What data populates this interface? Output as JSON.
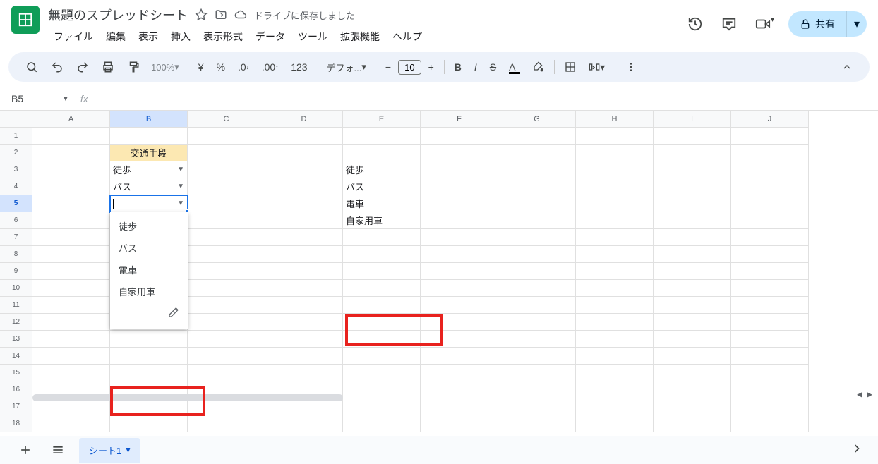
{
  "header": {
    "doc_title": "無題のスプレッドシート",
    "save_status": "ドライブに保存しました",
    "share_label": "共有"
  },
  "menubar": [
    "ファイル",
    "編集",
    "表示",
    "挿入",
    "表示形式",
    "データ",
    "ツール",
    "拡張機能",
    "ヘルプ"
  ],
  "toolbar": {
    "zoom": "100%",
    "currency": "¥",
    "percent": "%",
    "dec_dec": ".0",
    "inc_dec": ".00",
    "num_format": "123",
    "font": "デフォ...",
    "minus": "−",
    "font_size": "10",
    "plus": "+"
  },
  "namebox": {
    "ref": "B5",
    "fx": "fx"
  },
  "columns": [
    "A",
    "B",
    "C",
    "D",
    "E",
    "F",
    "G",
    "H",
    "I",
    "J"
  ],
  "rows_count": 18,
  "active_row": 5,
  "active_col": "B",
  "cells": {
    "B2": "交通手段",
    "B3": "徒歩",
    "B4": "バス",
    "E3": "徒歩",
    "E4": "バス",
    "E5": "電車",
    "E6": "自家用車"
  },
  "dropdown": {
    "items": [
      "徒歩",
      "バス",
      "電車",
      "自家用車"
    ]
  },
  "sheet_tab": "シート1"
}
